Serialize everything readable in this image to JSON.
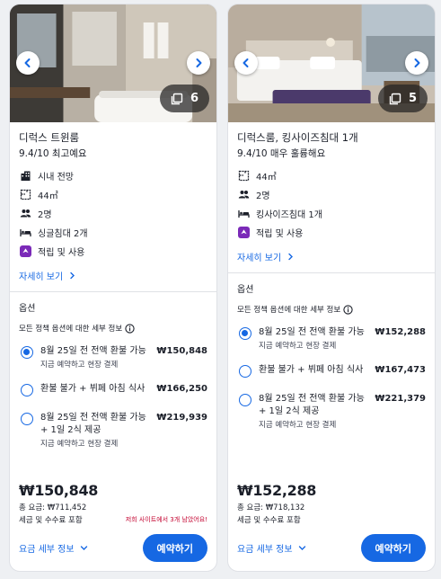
{
  "icons": {
    "prev": "chevron-left-icon",
    "next": "chevron-right-icon",
    "gallery": "gallery-icon",
    "view": "building-icon",
    "size": "floor-plan-icon",
    "sleeps": "people-icon",
    "bed": "bed-icon",
    "rewards": "rewards-icon",
    "info": "info-icon",
    "more": "chevron-right-small-icon",
    "fees": "chevron-down-icon"
  },
  "colors": {
    "accent": "#1668e3",
    "rewards": "#7b2ab8",
    "urgency": "#c3002e"
  },
  "cards": [
    {
      "photo_count": "6",
      "name": "디럭스 트윈룸",
      "rating": "9.4/10 최고예요",
      "amenities": [
        {
          "icon": "view",
          "text": "시내 전망"
        },
        {
          "icon": "size",
          "text": "44㎡"
        },
        {
          "icon": "sleeps",
          "text": "2명"
        },
        {
          "icon": "bed",
          "text": "싱글침대 2개"
        },
        {
          "icon": "rewards",
          "text": "적립 및 사용"
        }
      ],
      "more_link": "자세히 보기",
      "options_title": "옵션",
      "policy_text": "모든 정책 옵션에 대한 세부 정보",
      "options": [
        {
          "label": "8월 25일 전 전액 환불 가능",
          "price": "₩150,848",
          "sub": "지금 예약하고 현장 결제",
          "selected": true
        },
        {
          "label": "환불 불가 + 뷔페 아침 식사",
          "price": "₩166,250",
          "sub": "",
          "selected": false
        },
        {
          "label": "8월 25일 전 전액 환불 가능 + 1일 2식 제공",
          "price": "₩219,939",
          "sub": "지금 예약하고 현장 결제",
          "selected": false
        }
      ],
      "price": "₩150,848",
      "total": "총 요금: ₩711,452",
      "tax": "세금 및 수수료 포함",
      "scarcity": "저희 사이트에서 3개 남았어요!",
      "fees_link": "요금 세부 정보",
      "book_label": "예약하기"
    },
    {
      "photo_count": "5",
      "name": "디럭스룸, 킹사이즈침대 1개",
      "rating": "9.4/10 매우 훌륭해요",
      "amenities": [
        {
          "icon": "size",
          "text": "44㎡"
        },
        {
          "icon": "sleeps",
          "text": "2명"
        },
        {
          "icon": "bed",
          "text": "킹사이즈침대 1개"
        },
        {
          "icon": "rewards",
          "text": "적립 및 사용"
        }
      ],
      "more_link": "자세히 보기",
      "options_title": "옵션",
      "policy_text": "모든 정책 옵션에 대한 세부 정보",
      "options": [
        {
          "label": "8월 25일 전 전액 환불 가능",
          "price": "₩152,288",
          "sub": "지금 예약하고 현장 결제",
          "selected": true
        },
        {
          "label": "환불 불가 + 뷔페 아침 식사",
          "price": "₩167,473",
          "sub": "",
          "selected": false
        },
        {
          "label": "8월 25일 전 전액 환불 가능 + 1일 2식 제공",
          "price": "₩221,379",
          "sub": "지금 예약하고 현장 결제",
          "selected": false
        }
      ],
      "price": "₩152,288",
      "total": "총 요금: ₩718,132",
      "tax": "세금 및 수수료 포함",
      "scarcity": "",
      "fees_link": "요금 세부 정보",
      "book_label": "예약하기"
    }
  ]
}
